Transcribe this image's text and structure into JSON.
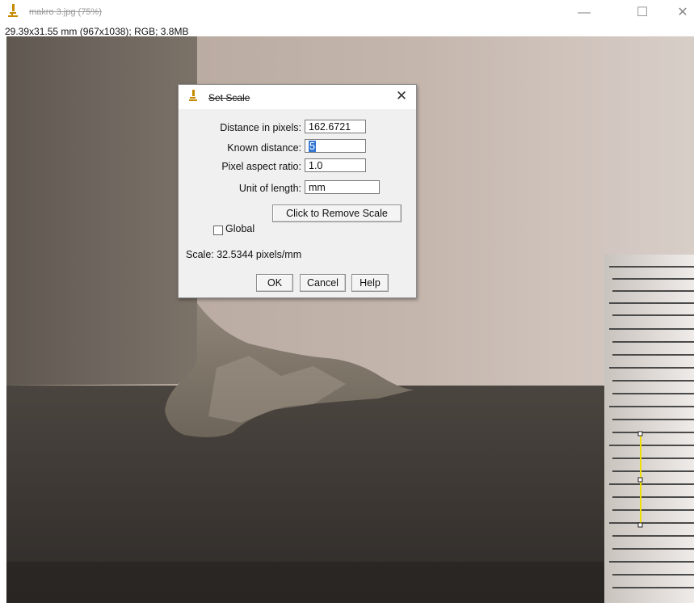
{
  "window": {
    "title": "makro 3.jpg (75%)",
    "info": "29.39x31.55 mm (967x1038); RGB; 3.8MB",
    "controls": {
      "minimize": "—",
      "maximize": "☐",
      "close": "✕"
    }
  },
  "dialog": {
    "title": "Set Scale",
    "close_glyph": "✕",
    "distance_label": "Distance in pixels:",
    "distance_value": "162.6721",
    "known_label": "Known distance:",
    "known_value": "5",
    "aspect_label": "Pixel aspect ratio:",
    "aspect_value": "1.0",
    "unit_label": "Unit of length:",
    "unit_value": "mm",
    "remove_scale_button": "Click to Remove Scale",
    "global_label": "Global",
    "global_checked": false,
    "scale_text": "Scale: 32.5344 pixels/mm",
    "ok_button": "OK",
    "cancel_button": "Cancel",
    "help_button": "Help"
  },
  "colors": {
    "selection_line": "#f0e000",
    "dialog_bg": "#f0f0f0",
    "icon_accent": "#c58a00"
  },
  "icons": [
    "imagej-microscope-icon",
    "minimize-icon",
    "maximize-icon",
    "close-icon"
  ]
}
